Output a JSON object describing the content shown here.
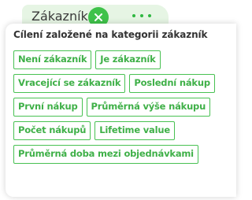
{
  "tab": {
    "label": "Zákazník"
  },
  "section": {
    "title": "Cílení založené na kategorii zákazník"
  },
  "chips": [
    "Není zákazník",
    "Je zákazník",
    "Vracející se zákazník",
    "Poslední nákup",
    "První nákup",
    "Průměrná výše nákupu",
    "Počet nákupů",
    "Lifetime value",
    "Průměrná doba mezi objednávkami"
  ],
  "colors": {
    "accent": "#3fc24a",
    "tab_background": "#e6f5e4",
    "chip_text": "#3fb048"
  },
  "icons": {
    "close": "close-icon",
    "more": "more-dots-icon"
  }
}
